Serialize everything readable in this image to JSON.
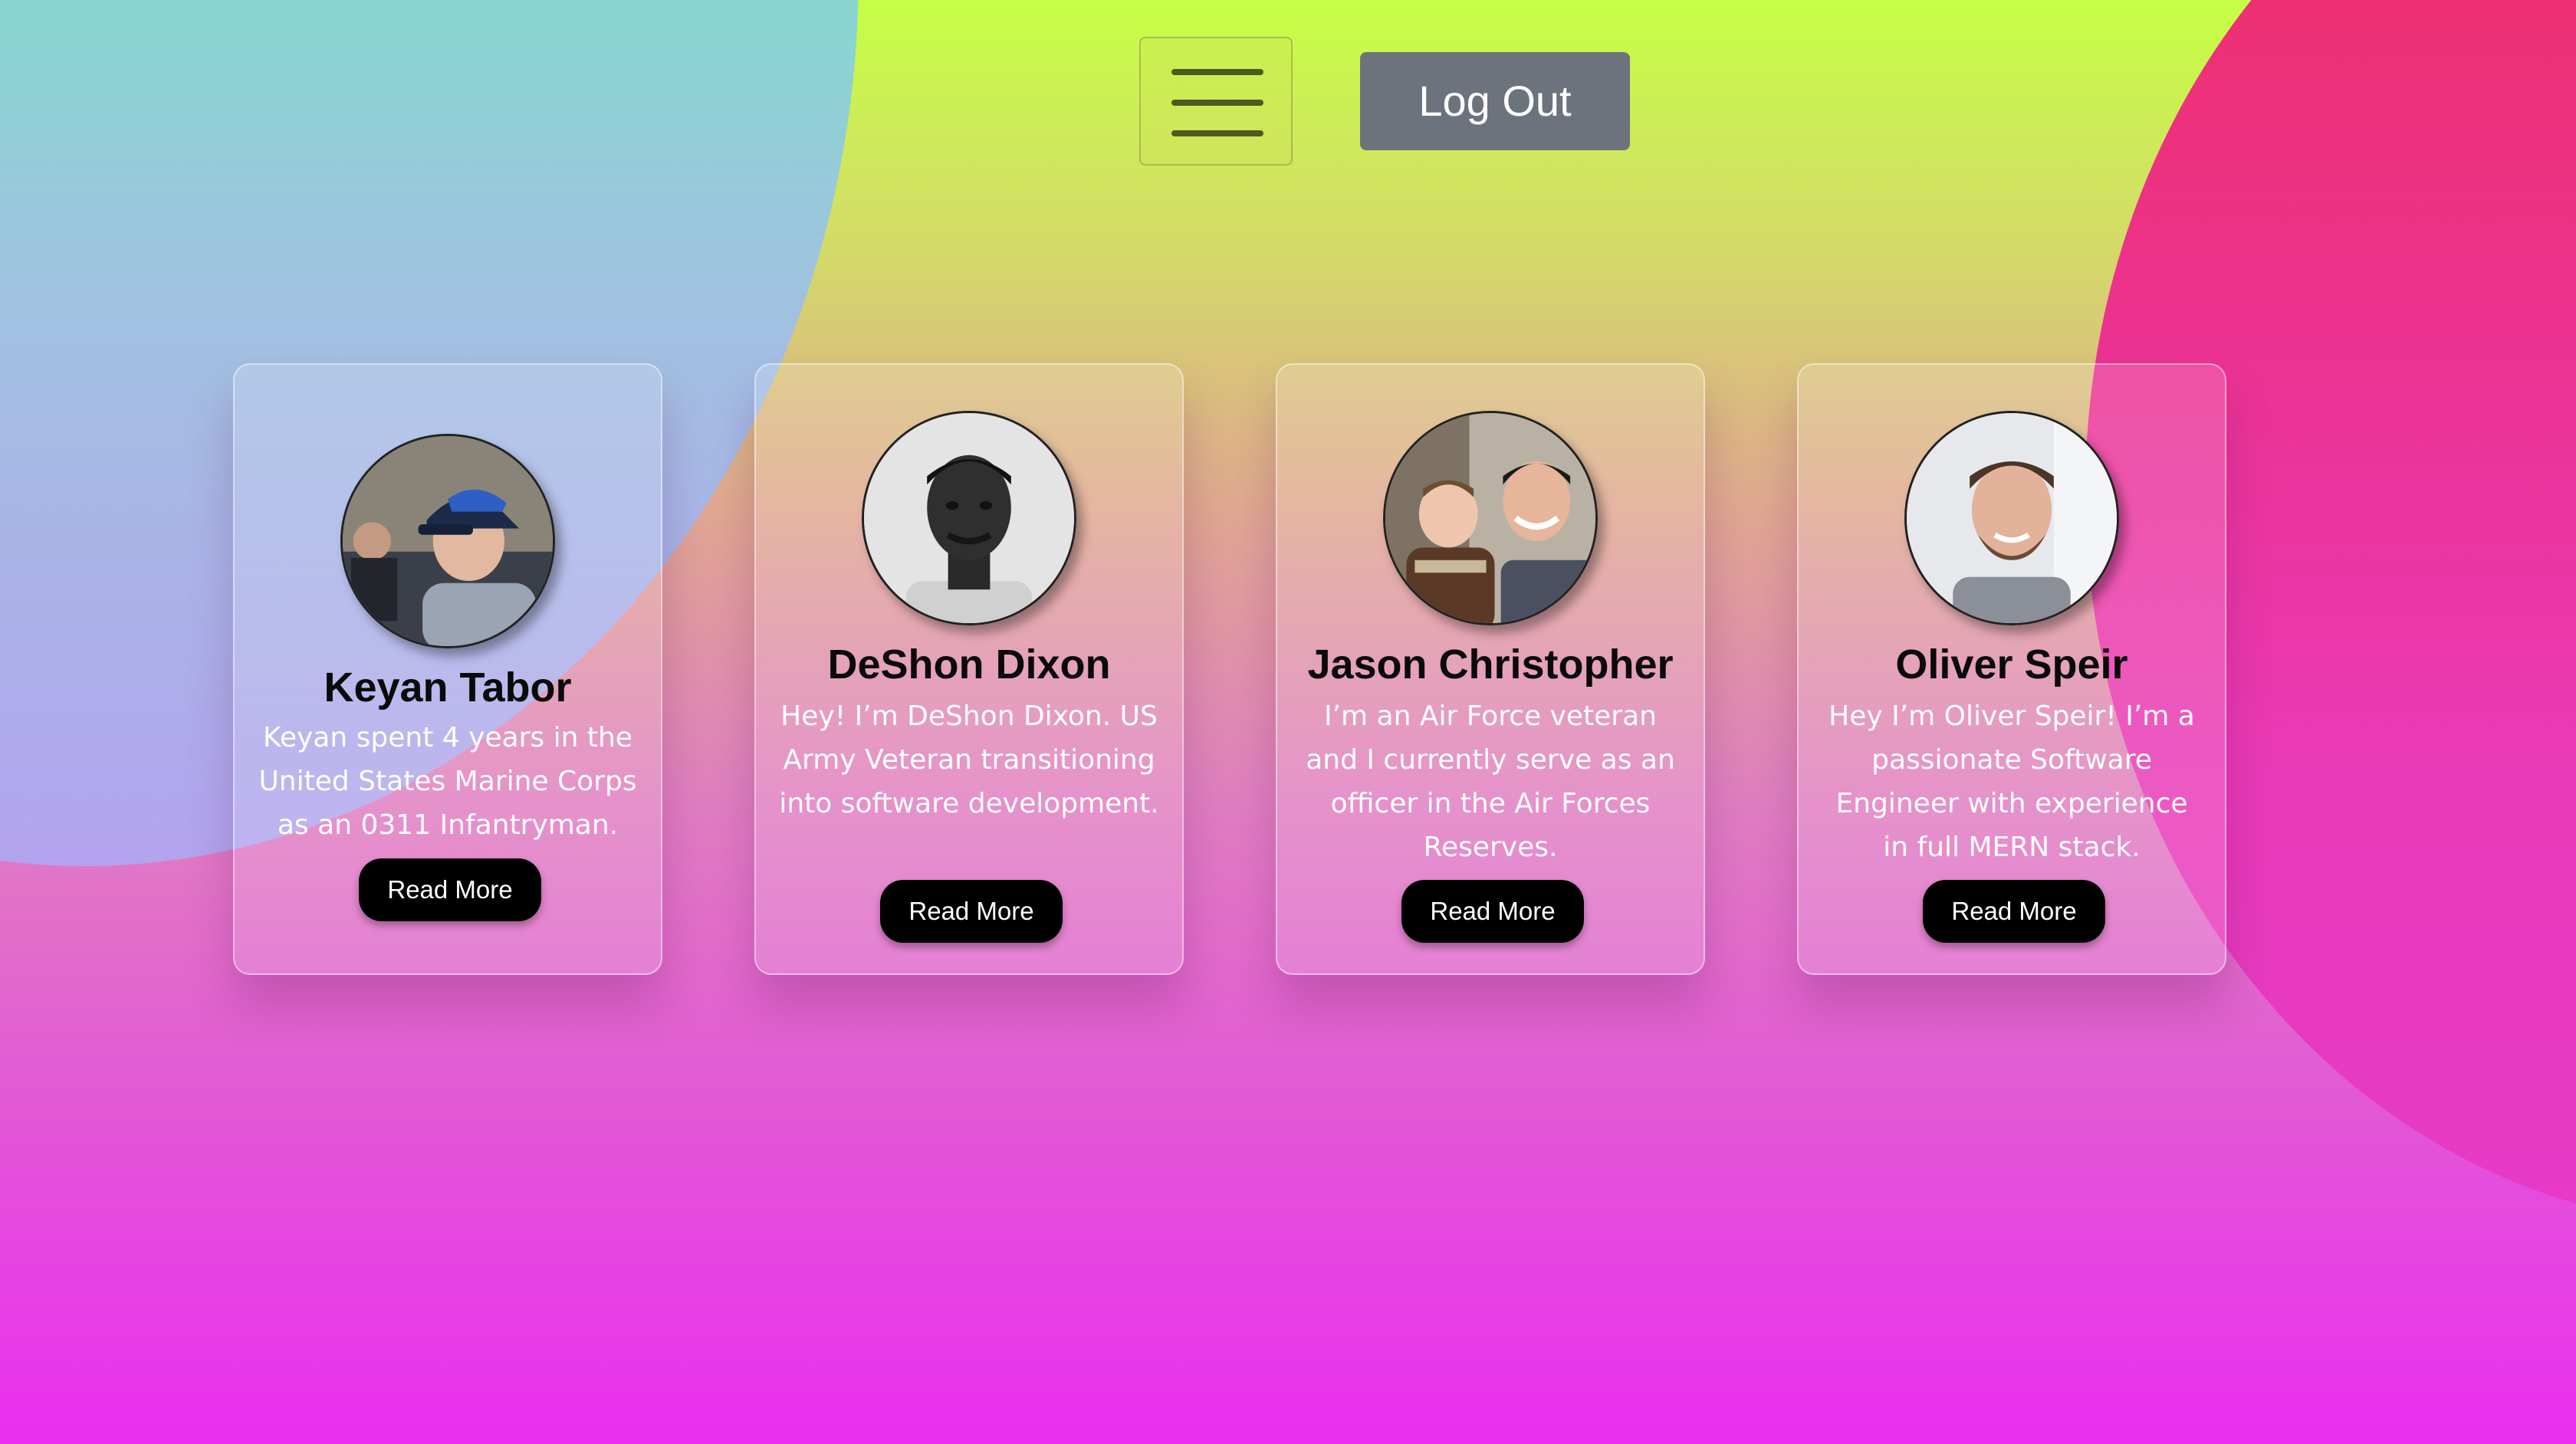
{
  "header": {
    "menu_icon": "hamburger-menu-icon",
    "logout_label": "Log Out",
    "logout_color": "#6c737d"
  },
  "colors": {
    "background_top": "#c6ff45",
    "background_bottom": "#ea2ef0",
    "blob_left": "#6effd8",
    "blob_right": "#ef2f5e",
    "button_black": "#000000"
  },
  "team": [
    {
      "name": "Keyan Tabor",
      "bio": "Keyan spent 4 years in the United States Marine Corps as an 0311 Infantryman.",
      "button_label": "Read More",
      "photo": "profile-photo-icon"
    },
    {
      "name": "DeShon Dixon",
      "bio": "Hey! I’m DeShon Dixon. US Army Veteran transitioning into software development.",
      "button_label": "Read More",
      "photo": "profile-photo-icon"
    },
    {
      "name": "Jason Christopher",
      "bio": "I’m an Air Force veteran and I currently serve as an officer in the Air Forces Reserves.",
      "button_label": "Read More",
      "photo": "profile-photo-icon"
    },
    {
      "name": "Oliver Speir",
      "bio": "Hey I’m Oliver Speir! I’m a passionate Software Engineer with experience in full MERN stack.",
      "button_label": "Read More",
      "photo": "profile-photo-icon"
    }
  ]
}
